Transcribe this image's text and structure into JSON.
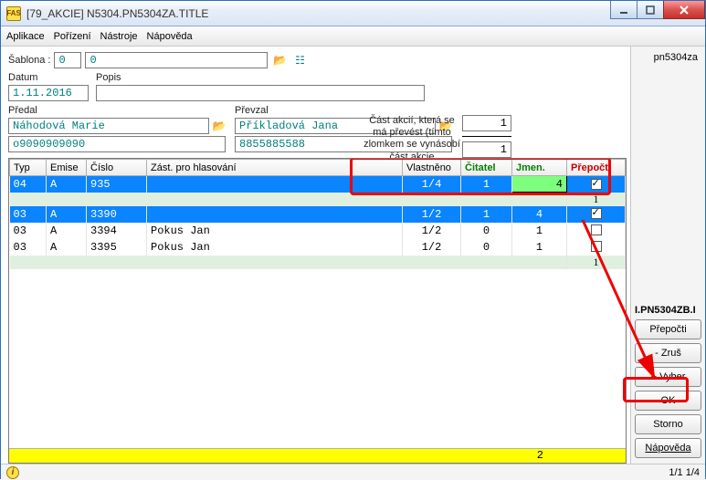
{
  "window": {
    "title": "[79_AKCIE] N5304.PN5304ZA.TITLE",
    "app_icon_text": "FAS"
  },
  "menu": {
    "aplikace": "Aplikace",
    "porizeni": "Pořízení",
    "nastroje": "Nástroje",
    "napoveda": "Nápověda"
  },
  "sablona": {
    "label": "Šablona :",
    "v1": "0",
    "v2": "0"
  },
  "sidebar": {
    "code": "pn5304za",
    "subcode": "I.PN5304ZB.I",
    "btn_prepocti": "Přepočti",
    "btn_zrus": "- Zruš",
    "btn_vyber": "+ Vyber",
    "btn_ok": "OK",
    "btn_storno": "Storno",
    "btn_napoveda": "Nápověda"
  },
  "form": {
    "datum_label": "Datum",
    "datum": "1.11.2016",
    "popis_label": "Popis",
    "popis": "",
    "predal_label": "Předal",
    "predal_name": "Náhodová Marie",
    "predal_num": "o9090909090",
    "prevzal_label": "Převzal",
    "prevzal_name": "Příkladová Jana",
    "prevzal_num": "8855885588"
  },
  "fraction": {
    "text": "Část akcií, která se má převést (tímto zlomkem se vynásobí část akcie předávajícího)",
    "num": "1",
    "den": "1"
  },
  "table": {
    "headers": {
      "typ": "Typ",
      "emise": "Emise",
      "cislo": "Číslo",
      "zast": "Zást. pro hlasování",
      "vlastneno": "Vlastněno",
      "citatel": "Čitatel",
      "jmen": "Jmen.",
      "prepocti": "Přepočti"
    },
    "rows": [
      {
        "sel": true,
        "typ": "04",
        "emise": "A",
        "cislo": "935",
        "zast": "",
        "vlast": "1/4",
        "cit": "1",
        "jmen": "4",
        "chk": true,
        "edit": true
      },
      {
        "div": true,
        "sum": "1"
      },
      {
        "sel": true,
        "typ": "03",
        "emise": "A",
        "cislo": "3390",
        "zast": "",
        "vlast": "1/2",
        "cit": "1",
        "jmen": "4",
        "chk": true
      },
      {
        "sel": false,
        "typ": "03",
        "emise": "A",
        "cislo": "3394",
        "zast": "Pokus Jan",
        "vlast": "1/2",
        "cit": "0",
        "jmen": "1",
        "chk": false
      },
      {
        "sel": false,
        "typ": "03",
        "emise": "A",
        "cislo": "3395",
        "zast": "Pokus Jan",
        "vlast": "1/2",
        "cit": "0",
        "jmen": "1",
        "chk": false
      },
      {
        "div": true,
        "sum": "1"
      }
    ],
    "footer_count": "2"
  },
  "status": {
    "right": "1/1  1/4"
  }
}
